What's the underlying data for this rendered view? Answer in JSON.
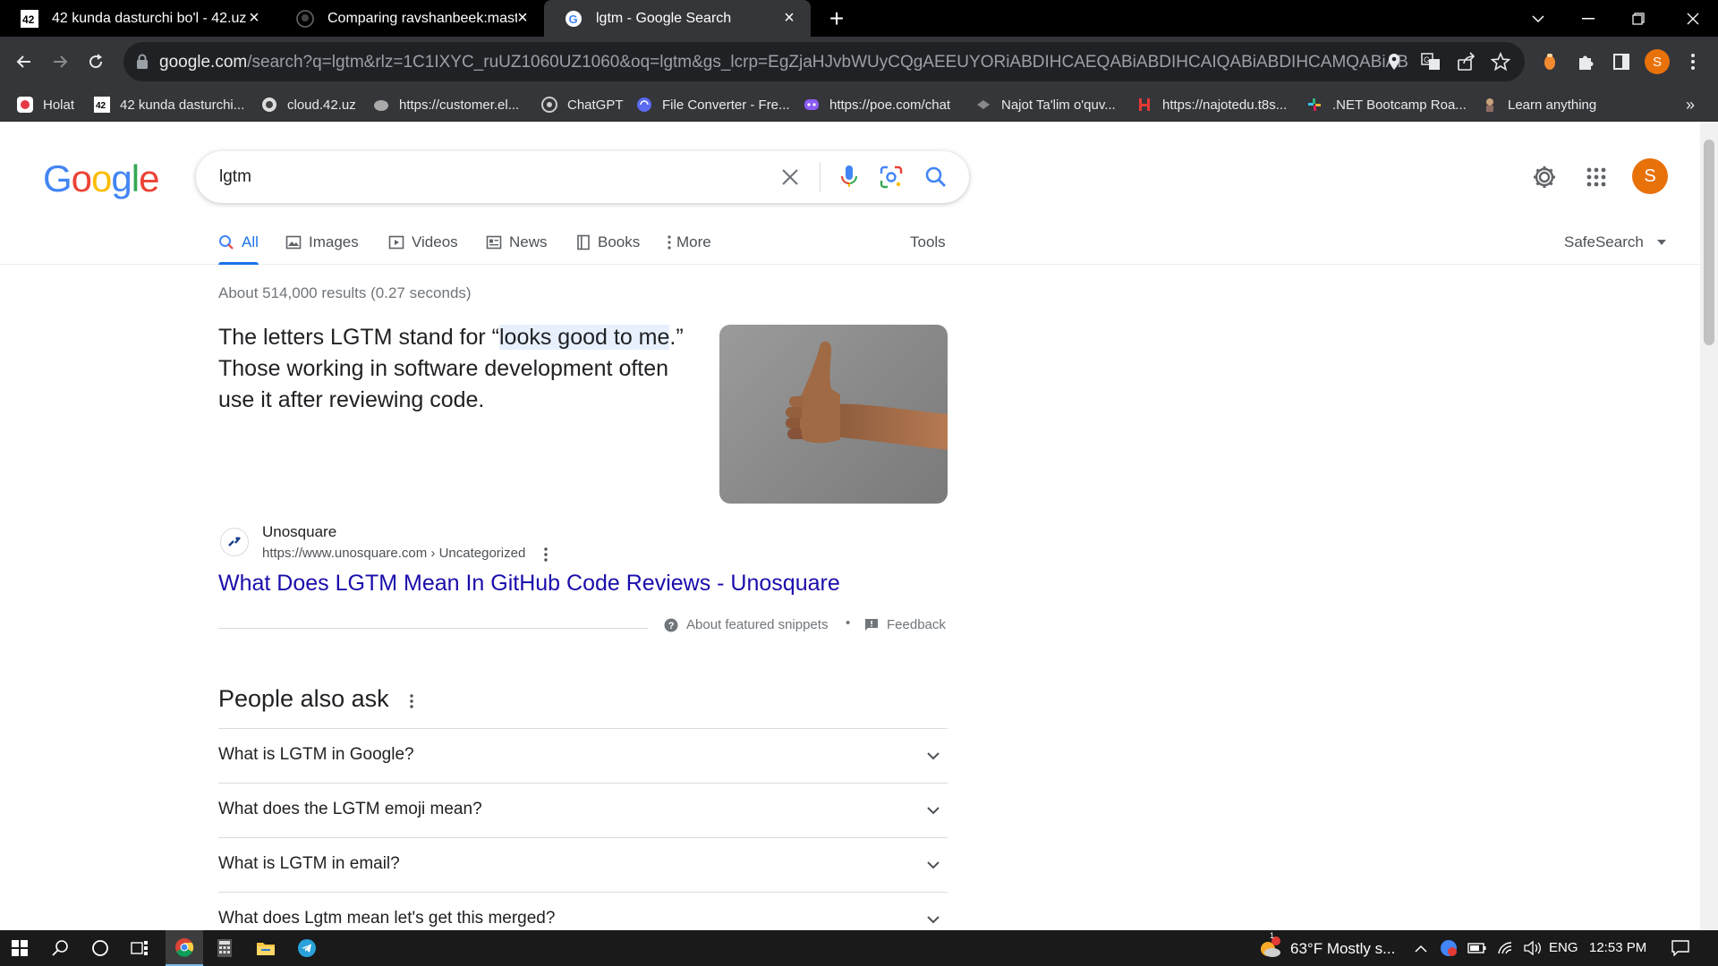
{
  "browser": {
    "tabs": [
      {
        "title": "42 kunda dasturchi bo'l - 42.uz",
        "favicon": "42-logo-icon",
        "active": false
      },
      {
        "title": "Comparing ravshanbeek:master...",
        "favicon": "github-icon",
        "active": false
      },
      {
        "title": "lgtm - Google Search",
        "favicon": "google-icon",
        "active": true
      }
    ],
    "url_host": "google.com",
    "url_rest": "/search?q=lgtm&rlz=1C1IXYC_ruUZ1060UZ1060&oq=lgtm&gs_lcrp=EgZjaHJvbWUyCQgAEEUYORiABDIHCAEQABiABDIHCAIQABiABDIHCAMQABiABDIHCAQQABi...",
    "profile_initial": "S",
    "bookmarks": [
      {
        "label": "Holat",
        "icon": "holat-icon"
      },
      {
        "label": "42 kunda dasturchi...",
        "icon": "42-logo-icon"
      },
      {
        "label": "cloud.42.uz",
        "icon": "cloud-icon"
      },
      {
        "label": "https://customer.el...",
        "icon": "elephant-icon"
      },
      {
        "label": "ChatGPT",
        "icon": "chatgpt-icon"
      },
      {
        "label": "File Converter - Fre...",
        "icon": "file-converter-icon"
      },
      {
        "label": "https://poe.com/chat",
        "icon": "poe-icon"
      },
      {
        "label": "Najot Ta'lim o'quv...",
        "icon": "najot-icon"
      },
      {
        "label": "https://najotedu.t8s...",
        "icon": "najotedu-icon"
      },
      {
        "label": ".NET Bootcamp Roa...",
        "icon": "slack-icon"
      },
      {
        "label": "Learn anything",
        "icon": "learn-icon"
      }
    ]
  },
  "google": {
    "logo": "Google",
    "query": "lgtm",
    "tabs": [
      {
        "label": "All",
        "icon": "search-icon"
      },
      {
        "label": "Images",
        "icon": "image-icon"
      },
      {
        "label": "Videos",
        "icon": "video-icon"
      },
      {
        "label": "News",
        "icon": "news-icon"
      },
      {
        "label": "Books",
        "icon": "book-icon"
      },
      {
        "label": "More",
        "icon": "more-vert-icon"
      }
    ],
    "tools_label": "Tools",
    "safesearch_label": "SafeSearch",
    "result_stats": "About 514,000 results (0.27 seconds)",
    "snippet": {
      "before": "The letters LGTM stand for “",
      "highlight": "looks good to me",
      "after": ".” Those working in software development often use it after reviewing code."
    },
    "source": {
      "name": "Unosquare",
      "url": "https://www.unosquare.com › Uncategorized",
      "title": "What Does LGTM Mean In GitHub Code Reviews - Unosquare"
    },
    "about_snippets": "About featured snippets",
    "feedback": "Feedback",
    "separator": "•",
    "paa_title": "People also ask",
    "paa": [
      "What is LGTM in Google?",
      "What does the LGTM emoji mean?",
      "What is LGTM in email?",
      "What does Lgtm mean let's get this merged?"
    ],
    "avatar_initial": "S"
  },
  "taskbar": {
    "weather": "63°F  Mostly s...",
    "weather_badge": "1",
    "language": "ENG",
    "time": "12:53 PM"
  },
  "colors": {
    "google_blue": "#4285F4",
    "google_red": "#EA4335",
    "google_yellow": "#FBBC05",
    "google_green": "#34A853",
    "link": "#1a0dab",
    "avatar": "#e8710a"
  }
}
